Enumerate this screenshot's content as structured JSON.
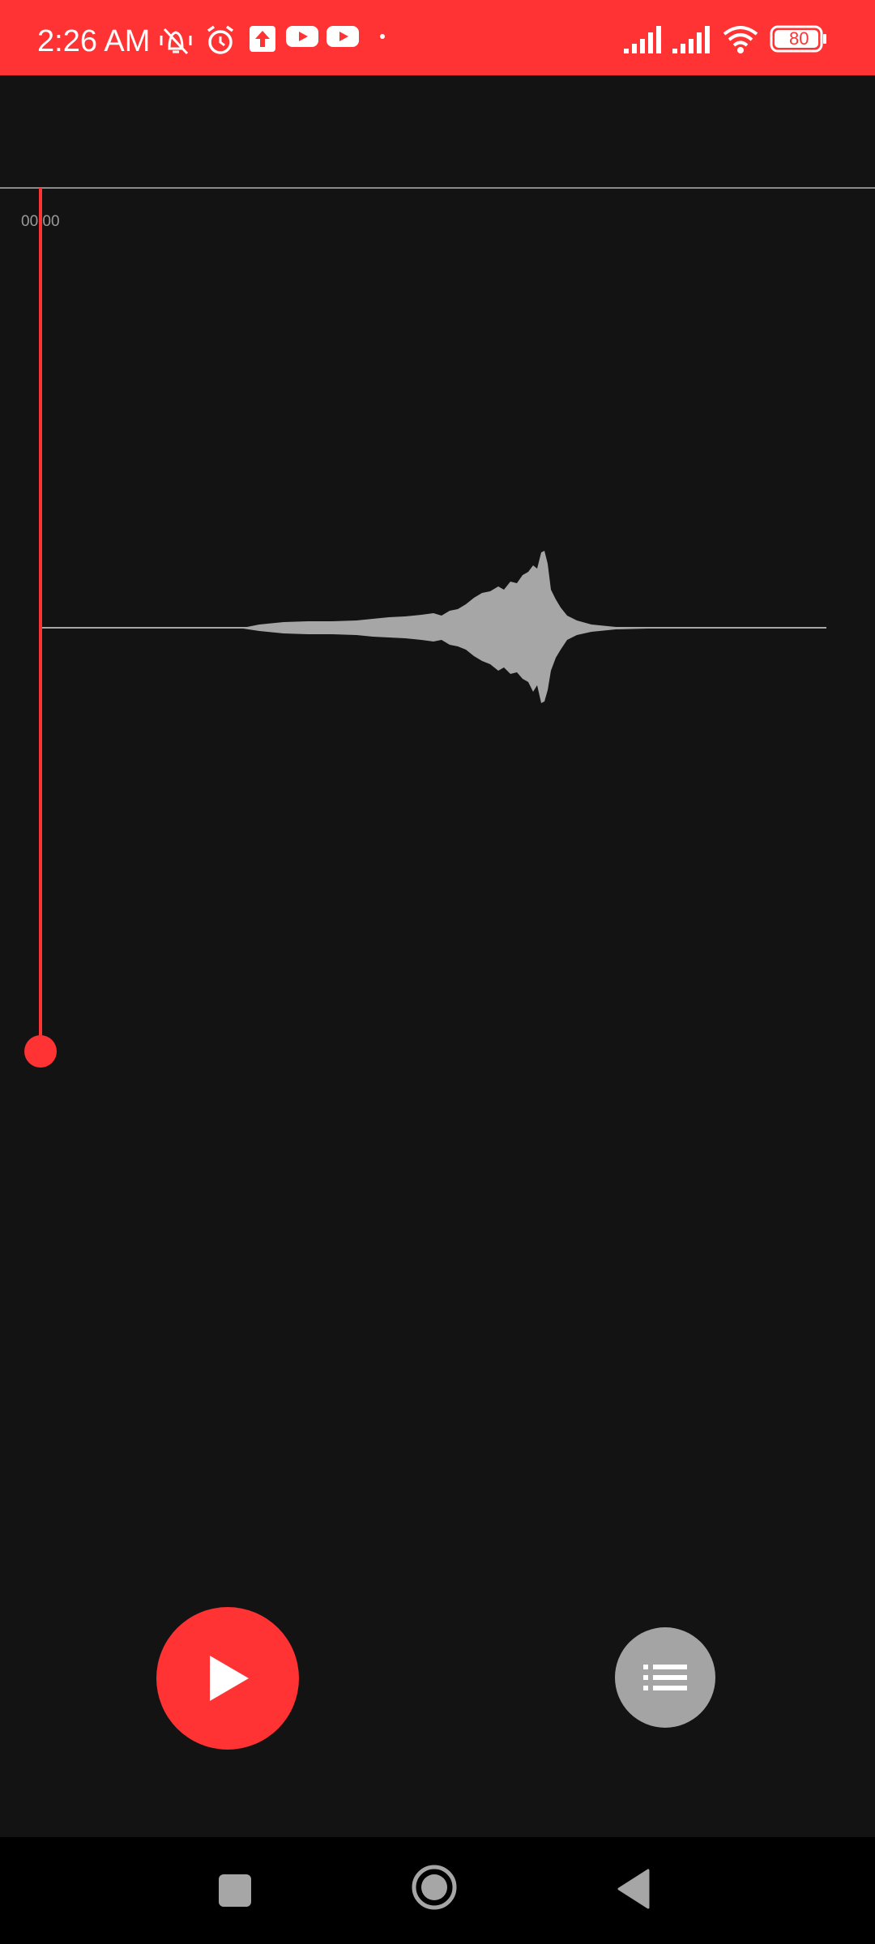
{
  "status_bar": {
    "time": "2:26 AM",
    "battery_level": "80",
    "background_color": "#ff3333",
    "left_icons": [
      "vibrate-silent-icon",
      "alarm-icon",
      "upload-icon",
      "youtube-icon",
      "youtube-icon",
      "dot-icon"
    ],
    "right_icons": [
      "signal-icon",
      "signal-icon",
      "wifi-icon",
      "battery-icon"
    ]
  },
  "recorder": {
    "elapsed_time": "00:00",
    "playhead_color": "#ff3333",
    "waveform_color": "#a6a6a6"
  },
  "controls": {
    "play_icon": "play-icon",
    "list_icon": "list-icon"
  },
  "navigation_bar": {
    "icons": [
      "recents-square-icon",
      "home-circle-icon",
      "back-triangle-icon"
    ]
  }
}
